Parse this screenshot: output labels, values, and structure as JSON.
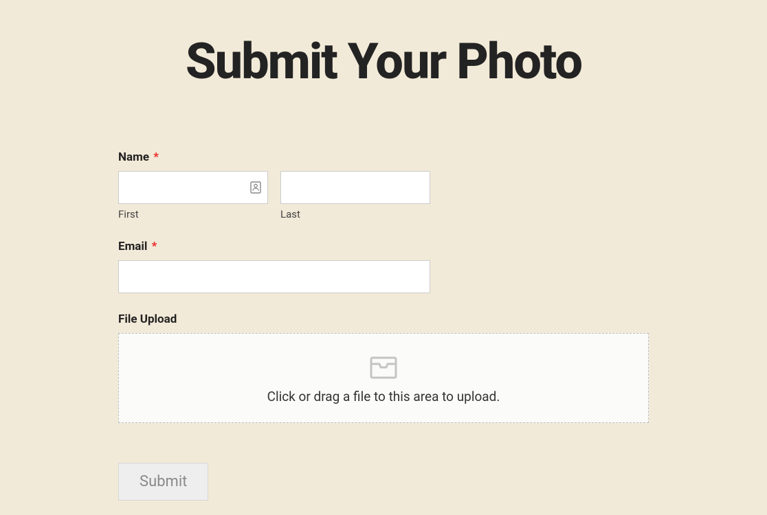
{
  "page": {
    "title": "Submit Your Photo"
  },
  "form": {
    "name": {
      "label": "Name",
      "required_mark": "*",
      "first": {
        "value": "",
        "sub_label": "First"
      },
      "last": {
        "value": "",
        "sub_label": "Last"
      }
    },
    "email": {
      "label": "Email",
      "required_mark": "*",
      "value": ""
    },
    "file_upload": {
      "label": "File Upload",
      "dropzone_text": "Click or drag a file to this area to upload."
    },
    "submit_label": "Submit"
  }
}
